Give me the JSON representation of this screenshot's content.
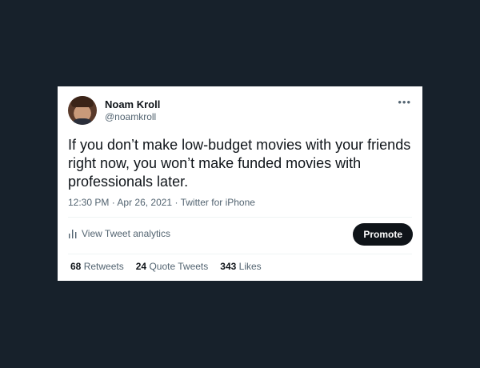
{
  "user": {
    "name": "Noam Kroll",
    "handle": "@noamkroll"
  },
  "menu_icon": "more-horizontal-icon",
  "tweet": {
    "text": "If you don’t make low-budget movies with your friends right now, you won’t make funded movies with professionals later.",
    "time": "12:30 PM",
    "date": "Apr 26, 2021",
    "source": "Twitter for iPhone",
    "separator": " · "
  },
  "actions": {
    "analytics_label": "View Tweet analytics",
    "analytics_icon": "bar-chart-icon",
    "promote_label": "Promote"
  },
  "stats": {
    "retweets_count": "68",
    "retweets_label": "Retweets",
    "quotes_count": "24",
    "quotes_label": "Quote Tweets",
    "likes_count": "343",
    "likes_label": "Likes"
  },
  "colors": {
    "background": "#17212b",
    "card": "#ffffff",
    "text_primary": "#0f1419",
    "text_secondary": "#536471",
    "button": "#0f1419"
  }
}
